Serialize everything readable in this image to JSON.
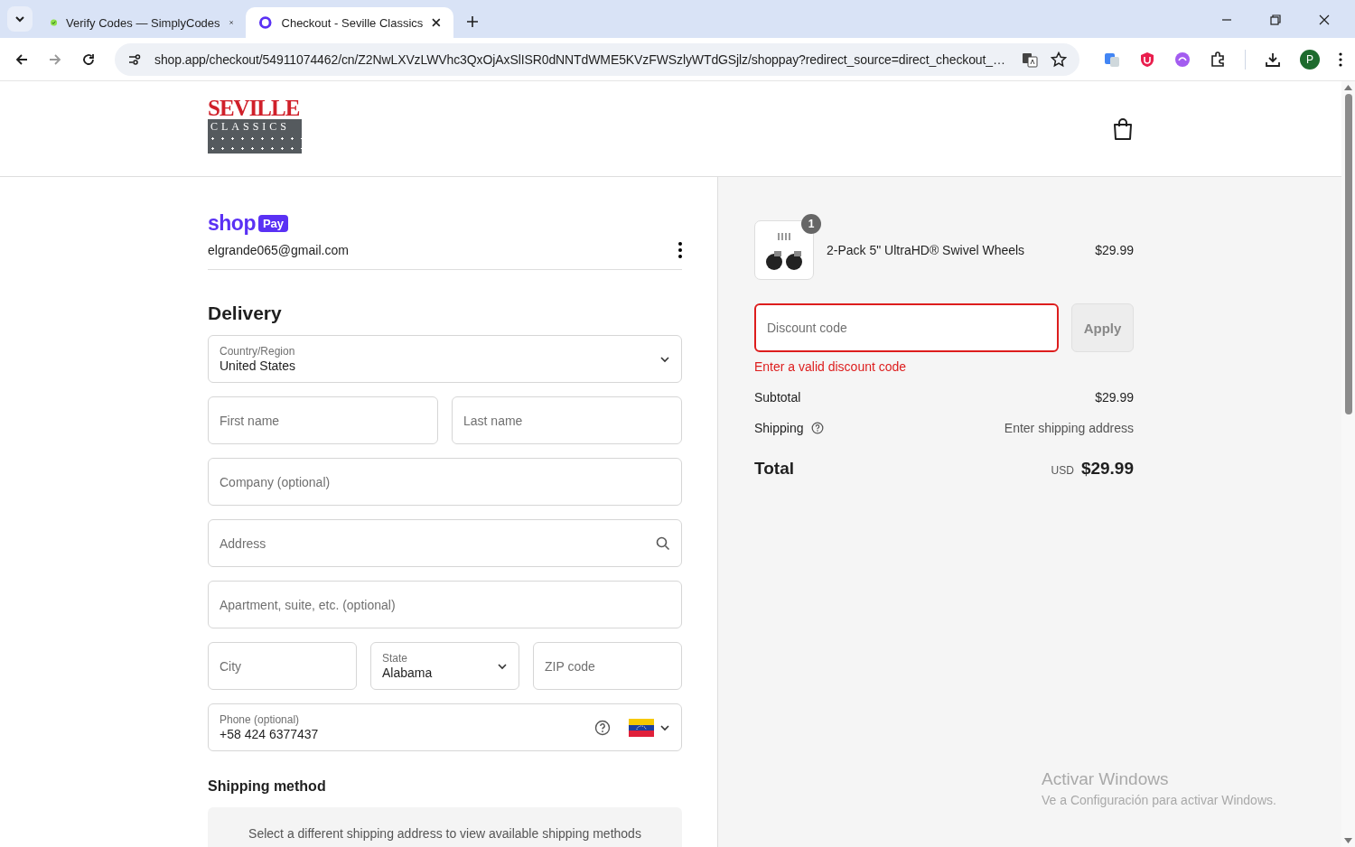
{
  "browser": {
    "tabs": [
      {
        "title": "Verify Codes — SimplyCodes",
        "kind": "check",
        "selected": false
      },
      {
        "title": "Checkout - Seville Classics",
        "kind": "shop",
        "selected": true
      }
    ],
    "url": "shop.app/checkout/54911074462/cn/Z2NwLXVzLWVhc3QxOjAxSlISR0dNNTdWME5KVzFWSzlyWTdGSjlz/shoppay?redirect_source=direct_checkout_…",
    "profile": "P"
  },
  "header": {
    "logo_top": "SEVILLE",
    "logo_bottom": "CLASSICS"
  },
  "account": {
    "brand": "shop",
    "badge": "Pay",
    "email": "elgrande065@gmail.com"
  },
  "delivery": {
    "title": "Delivery",
    "rows": [
      {
        "fields": [
          {
            "kind": "select",
            "label": "Country/Region",
            "value": "United States"
          }
        ]
      },
      {
        "fields": [
          {
            "kind": "text",
            "placeholder": "First name"
          },
          {
            "kind": "text",
            "placeholder": "Last name"
          }
        ]
      },
      {
        "fields": [
          {
            "kind": "text",
            "placeholder": "Company (optional)"
          }
        ]
      },
      {
        "fields": [
          {
            "kind": "search",
            "placeholder": "Address"
          }
        ]
      },
      {
        "fields": [
          {
            "kind": "text",
            "placeholder": "Apartment, suite, etc. (optional)"
          }
        ]
      },
      {
        "fields": [
          {
            "kind": "text",
            "placeholder": "City"
          },
          {
            "kind": "select",
            "label": "State",
            "value": "Alabama"
          },
          {
            "kind": "text",
            "placeholder": "ZIP code"
          }
        ]
      },
      {
        "fields": [
          {
            "kind": "phone",
            "label": "Phone (optional)",
            "value": "+58 424 6377437"
          }
        ]
      }
    ]
  },
  "shipping_method": {
    "title": "Shipping method",
    "message": "Select a different shipping address to view available shipping methods"
  },
  "summary": {
    "items": [
      {
        "quantity": "1",
        "name": "2-Pack 5\" UltraHD® Swivel Wheels",
        "price": "$29.99"
      }
    ],
    "discount": {
      "placeholder": "Discount code",
      "invalid": true,
      "button": "Apply",
      "disabled": true,
      "error": "Enter a valid discount code"
    },
    "lines": [
      {
        "label": "Subtotal",
        "value": "$29.99",
        "help": false,
        "muted": false
      },
      {
        "label": "Shipping",
        "value": "Enter shipping address",
        "help": true,
        "muted": true
      }
    ],
    "total": {
      "label": "Total",
      "currency": "USD",
      "value": "$29.99"
    }
  },
  "os_notice": {
    "title": "Activar Windows",
    "message": "Ve a Configuración para activar Windows."
  }
}
